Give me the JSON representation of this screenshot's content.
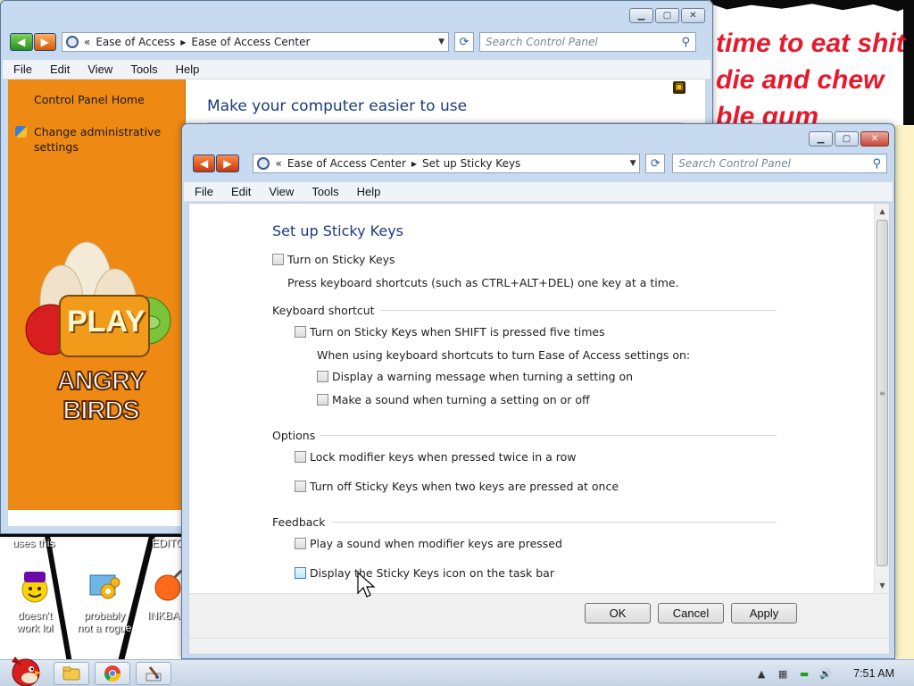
{
  "wallpaper": {
    "graffiti_lines": [
      "time to eat shit",
      "die and chew",
      "ble gum"
    ],
    "partial_labels": [
      "uses this",
      "EDITO"
    ]
  },
  "desktop_icons": [
    {
      "icon": "yahoo-messenger-icon",
      "label": "doesn't work lol"
    },
    {
      "icon": "control-panel-gears-icon",
      "label": "probably not a rogue"
    },
    {
      "icon": "inkball-icon",
      "label": "INKBA"
    }
  ],
  "back_window": {
    "nav": {
      "back": "◀",
      "forward": "▶"
    },
    "address": {
      "prefix": "«",
      "crumbs": [
        "Ease of Access",
        "Ease of Access Center"
      ]
    },
    "search_placeholder": "Search Control Panel",
    "menu": [
      "File",
      "Edit",
      "View",
      "Tools",
      "Help"
    ],
    "sidebar": {
      "home_link": "Control Panel Home",
      "admin_link": "Change administrative settings",
      "ad": {
        "play": "PLAY",
        "brand": "ANGRY BIRDS"
      }
    },
    "heading": "Make your computer easier to use"
  },
  "front_window": {
    "nav": {
      "back": "◀",
      "forward": "▶"
    },
    "address": {
      "prefix": "«",
      "crumbs": [
        "Ease of Access Center",
        "Set up Sticky Keys"
      ]
    },
    "search_placeholder": "Search Control Panel",
    "menu": [
      "File",
      "Edit",
      "View",
      "Tools",
      "Help"
    ],
    "title": "Set up Sticky Keys",
    "turn_on": {
      "label": "Turn on Sticky Keys",
      "checked": false
    },
    "turn_on_desc": "Press keyboard shortcuts (such as CTRL+ALT+DEL) one key at a time.",
    "keyboard_shortcut": {
      "heading": "Keyboard shortcut",
      "shift_option": {
        "label": "Turn on Sticky Keys when SHIFT is pressed five times",
        "checked": false
      },
      "sub_desc": "When using keyboard shortcuts to turn Ease of Access settings on:",
      "warning_option": {
        "label": "Display a warning message when turning a setting on",
        "checked": false
      },
      "sound_option": {
        "label": "Make a sound when turning a setting on or off",
        "checked": false
      }
    },
    "options": {
      "heading": "Options",
      "lock_option": {
        "label": "Lock modifier keys when pressed twice in a row",
        "checked": false
      },
      "turnoff_option": {
        "label": "Turn off Sticky Keys when two keys are pressed at once",
        "checked": false
      }
    },
    "feedback": {
      "heading": "Feedback",
      "play_sound_option": {
        "label": "Play a sound when modifier keys are pressed",
        "checked": false
      },
      "taskbar_icon_option": {
        "label": "Display the Sticky Keys icon on the task bar",
        "checked": false
      }
    },
    "buttons": {
      "ok": "OK",
      "cancel": "Cancel",
      "apply": "Apply"
    }
  },
  "taskbar": {
    "pinned": [
      "windows-explorer-icon",
      "chrome-icon",
      "paint-icon"
    ],
    "tray_icons": [
      "show-hidden-icons-chevron",
      "network-icon",
      "battery-icon",
      "volume-icon"
    ],
    "clock": "7:51 AM"
  },
  "colors": {
    "sidebar_orange": "#ee8913",
    "link_blue": "#1a3c7a",
    "graffiti_red": "#e8192c"
  }
}
